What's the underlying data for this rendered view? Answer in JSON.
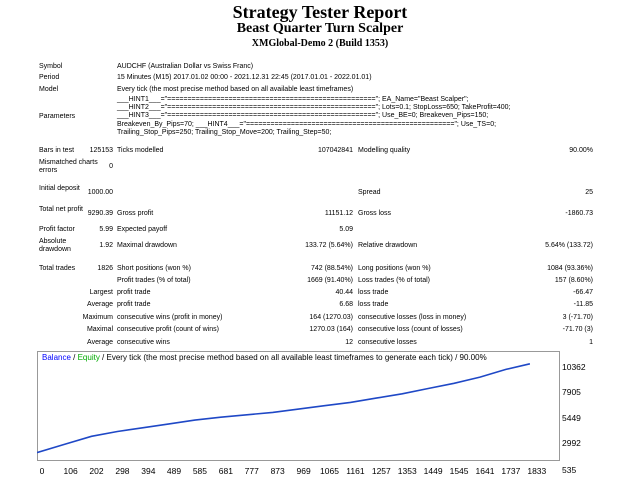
{
  "header": {
    "title": "Strategy Tester Report",
    "subtitle": "Beast Quarter Turn Scalper",
    "server": "XMGlobal-Demo 2 (Build 1353)"
  },
  "report": {
    "symbol_label": "Symbol",
    "symbol": "AUDCHF (Australian Dollar vs Swiss Franc)",
    "period_label": "Period",
    "period": "15 Minutes (M15) 2017.01.02 00:00 - 2021.12.31 22:45 (2017.01.01 - 2022.01.01)",
    "model_label": "Model",
    "model": "Every tick (the most precise method based on all available least timeframes)",
    "parameters_label": "Parameters",
    "parameters": [
      "___HINT1___=\"===================================================\"; EA_Name=\"Beast Scalper\";",
      "___HINT2___=\"===================================================\"; Lots=0.1; StopLoss=650; TakeProfit=400;",
      "___HINT3___=\"===================================================\"; Use_BE=0; Breakeven_Pips=150;",
      "Breakeven_By_Pips=70; ___HINT4___=\"===================================================\"; Use_TS=0;",
      "Trailing_Stop_Pips=250; Trailing_Stop_Move=200; Trailing_Step=50;"
    ],
    "bars_label": "Bars in test",
    "bars": "125153",
    "ticks_label": "Ticks modelled",
    "ticks": "107042841",
    "quality_label": "Modelling quality",
    "quality": "90.00%",
    "mismatch_label": "Mismatched charts errors",
    "mismatch": "0",
    "deposit_label": "Initial deposit",
    "deposit": "1000.00",
    "spread_label": "Spread",
    "spread": "25",
    "net_label": "Total net profit",
    "net": "9290.39",
    "gross_profit_label": "Gross profit",
    "gross_profit": "11151.12",
    "gross_loss_label": "Gross loss",
    "gross_loss": "-1860.73",
    "pf_label": "Profit factor",
    "pf": "5.99",
    "payoff_label": "Expected payoff",
    "payoff": "5.09",
    "abs_dd_label": "Absolute drawdown",
    "abs_dd": "1.92",
    "max_dd_label": "Maximal drawdown",
    "max_dd": "133.72 (5.64%)",
    "rel_dd_label": "Relative drawdown",
    "rel_dd": "5.64% (133.72)",
    "trades_label": "Total trades",
    "trades": "1826",
    "short_label": "Short positions (won %)",
    "short": "742 (88.54%)",
    "long_label": "Long positions (won %)",
    "long": "1084 (93.36%)",
    "pt_label": "Profit trades (% of total)",
    "pt": "1669 (91.40%)",
    "lt_label": "Loss trades (% of total)",
    "lt": "157 (8.60%)",
    "largest_label": "Largest",
    "largest_pt_label": "profit trade",
    "largest_pt": "40.44",
    "largest_lt_label": "loss trade",
    "largest_lt": "-66.47",
    "average_label": "Average",
    "avg_pt_label": "profit trade",
    "avg_pt": "6.68",
    "avg_lt_label": "loss trade",
    "avg_lt": "-11.85",
    "maximum_label": "Maximum",
    "max_cw_label": "consecutive wins (profit in money)",
    "max_cw": "164 (1270.03)",
    "max_cl_label": "consecutive losses (loss in money)",
    "max_cl": "3 (-71.70)",
    "maximal_label": "Maximal",
    "mxl_cp_label": "consecutive profit (count of wins)",
    "mxl_cp": "1270.03 (164)",
    "mxl_cl_label": "consecutive loss (count of losses)",
    "mxl_cl": "-71.70 (3)",
    "average2_label": "Average",
    "avg_cw_label": "consecutive wins",
    "avg_cw": "12",
    "avg_cl_label": "consecutive losses",
    "avg_cl": "1"
  },
  "chart_data": {
    "type": "line",
    "legend_balance": "Balance",
    "legend_sep1": " / ",
    "legend_equity": "Equity",
    "legend_rest": " / Every tick (the most precise method based on all available least timeframes to generate each tick) / 90.00%",
    "balance_color": "#0000ff",
    "equity_color": "#00aa00",
    "line_color": "#1f48c6",
    "xlim": [
      0,
      1930
    ],
    "ylim": [
      535,
      11000
    ],
    "y_ticks": [
      "10362",
      "7905",
      "5449",
      "2992",
      "535"
    ],
    "x_ticks": [
      "0",
      "106",
      "202",
      "298",
      "394",
      "489",
      "585",
      "681",
      "777",
      "873",
      "969",
      "1065",
      "1161",
      "1257",
      "1353",
      "1449",
      "1545",
      "1641",
      "1737",
      "1833"
    ],
    "series": [
      {
        "x": [
          0,
          106,
          202,
          298,
          394,
          489,
          585,
          681,
          777,
          873,
          969,
          1065,
          1161,
          1257,
          1353,
          1449,
          1545,
          1641,
          1737,
          1826
        ],
        "y": [
          1000,
          1900,
          2700,
          3200,
          3600,
          4000,
          4400,
          4700,
          4950,
          5200,
          5550,
          5900,
          6250,
          6700,
          7150,
          7700,
          8250,
          8900,
          9700,
          10290
        ]
      }
    ]
  }
}
